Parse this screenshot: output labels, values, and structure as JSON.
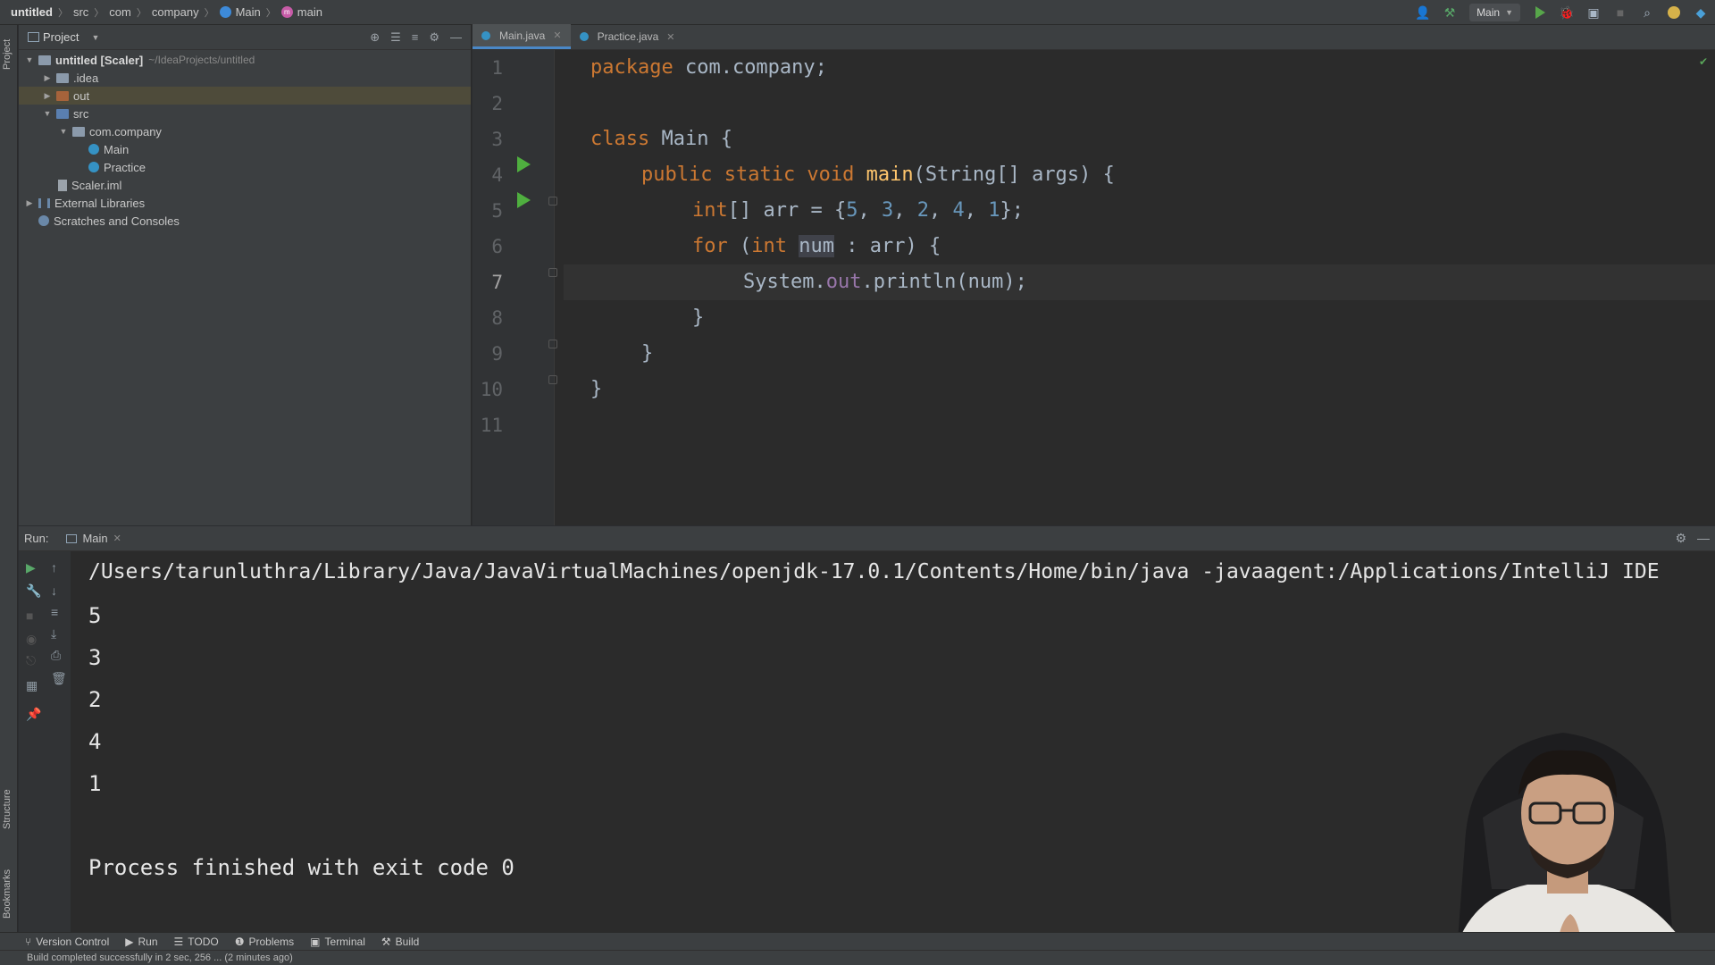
{
  "breadcrumbs": [
    "untitled",
    "src",
    "com",
    "company",
    "Main",
    "main"
  ],
  "toolbar": {
    "run_config": "Main"
  },
  "left_strip": {
    "project_label": "Project",
    "structure_label": "Structure",
    "bookmarks_label": "Bookmarks"
  },
  "project": {
    "title": "Project",
    "tree": [
      {
        "label": "untitled [Scaler]",
        "extra": "~/IdeaProjects/untitled"
      },
      {
        "label": ".idea"
      },
      {
        "label": "out"
      },
      {
        "label": "src"
      },
      {
        "label": "com.company"
      },
      {
        "label": "Main"
      },
      {
        "label": "Practice"
      },
      {
        "label": "Scaler.iml"
      },
      {
        "label": "External Libraries"
      },
      {
        "label": "Scratches and Consoles"
      }
    ]
  },
  "editor": {
    "tabs": [
      {
        "label": "Main.java"
      },
      {
        "label": "Practice.java"
      }
    ],
    "line_numbers": [
      "1",
      "2",
      "3",
      "4",
      "5",
      "6",
      "7",
      "8",
      "9",
      "10",
      "11"
    ],
    "code": {
      "l1_kw": "package",
      "l1_rest": " com.company;",
      "l3_kw": "class",
      "l3_rest": " Main {",
      "l4_kw": "public static void",
      "l4_fn": "main",
      "l4_rest": "(String[] args) {",
      "l5_kw": "int",
      "l5_a": "[] arr = {",
      "l5_n1": "5",
      "l5_c1": ", ",
      "l5_n2": "3",
      "l5_c2": ", ",
      "l5_n3": "2",
      "l5_c3": ", ",
      "l5_n4": "4",
      "l5_c4": ", ",
      "l5_n5": "1",
      "l5_end": "};",
      "l6_kw": "for",
      "l6_a": " (",
      "l6_kw2": "int",
      "l6_sp": " ",
      "l6_var": "num",
      "l6_rest": " : arr) {",
      "l7_a": "System.",
      "l7_fld": "out",
      "l7_b": ".println(num);",
      "l8": "}",
      "l9": "}",
      "l10": "}"
    }
  },
  "run": {
    "label": "Run:",
    "tab": "Main",
    "console": [
      "/Users/tarunluthra/Library/Java/JavaVirtualMachines/openjdk-17.0.1/Contents/Home/bin/java -javaagent:/Applications/IntelliJ IDE",
      "5",
      "3",
      "2",
      "4",
      "1",
      "Process finished with exit code 0"
    ]
  },
  "bottom_bar": [
    "Version Control",
    "Run",
    "TODO",
    "Problems",
    "Terminal",
    "Build"
  ],
  "status": "Build completed successfully in 2 sec, 256 ... (2 minutes ago)"
}
